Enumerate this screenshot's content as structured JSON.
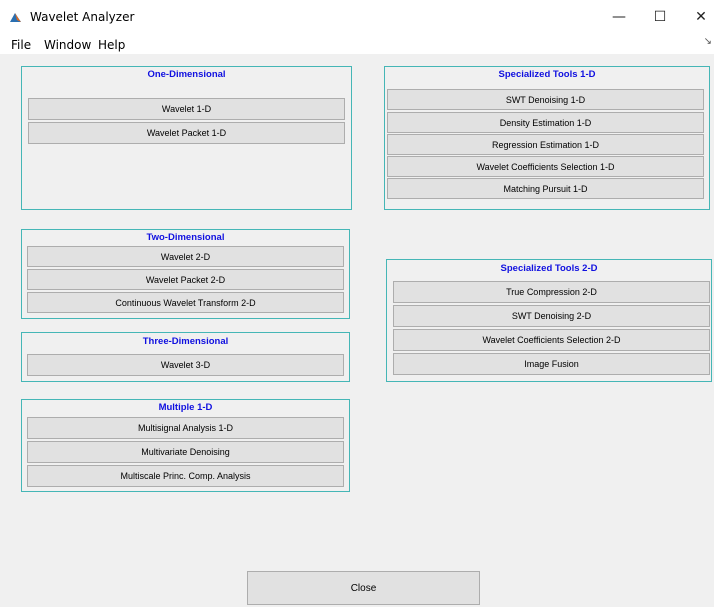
{
  "window": {
    "title": "Wavelet Analyzer",
    "minimize": "—",
    "maximize": "☐",
    "close": "✕"
  },
  "menu": {
    "items": [
      "File",
      "Window",
      "Help"
    ],
    "overflow_arrow": "↘"
  },
  "one_d": {
    "title": "One-Dimensional",
    "buttons": [
      "Wavelet 1-D",
      "Wavelet Packet 1-D"
    ]
  },
  "two_d": {
    "title": "Two-Dimensional",
    "buttons": [
      "Wavelet 2-D",
      "Wavelet Packet 2-D",
      "Continuous Wavelet Transform 2-D"
    ]
  },
  "three_d": {
    "title": "Three-Dimensional",
    "buttons": [
      "Wavelet 3-D"
    ]
  },
  "multiple_1d": {
    "title": "Multiple 1-D",
    "buttons": [
      "Multisignal Analysis 1-D",
      "Multivariate Denoising",
      "Multiscale Princ. Comp. Analysis"
    ]
  },
  "spec_1d": {
    "title": "Specialized Tools 1-D",
    "buttons": [
      "SWT Denoising 1-D",
      "Density Estimation 1-D",
      "Regression Estimation 1-D",
      "Wavelet Coefficients Selection 1-D",
      "Matching Pursuit 1-D"
    ]
  },
  "spec_2d": {
    "title": "Specialized Tools 2-D",
    "buttons": [
      "True Compression 2-D",
      "SWT Denoising 2-D",
      "Wavelet Coefficients Selection 2-D",
      "Image Fusion"
    ]
  },
  "footer": {
    "close_label": "Close"
  },
  "colors": {
    "panel_border": "#45b6b6",
    "panel_title": "#1010e0",
    "button_face": "#e1e1e1",
    "background": "#f0f0f0"
  }
}
